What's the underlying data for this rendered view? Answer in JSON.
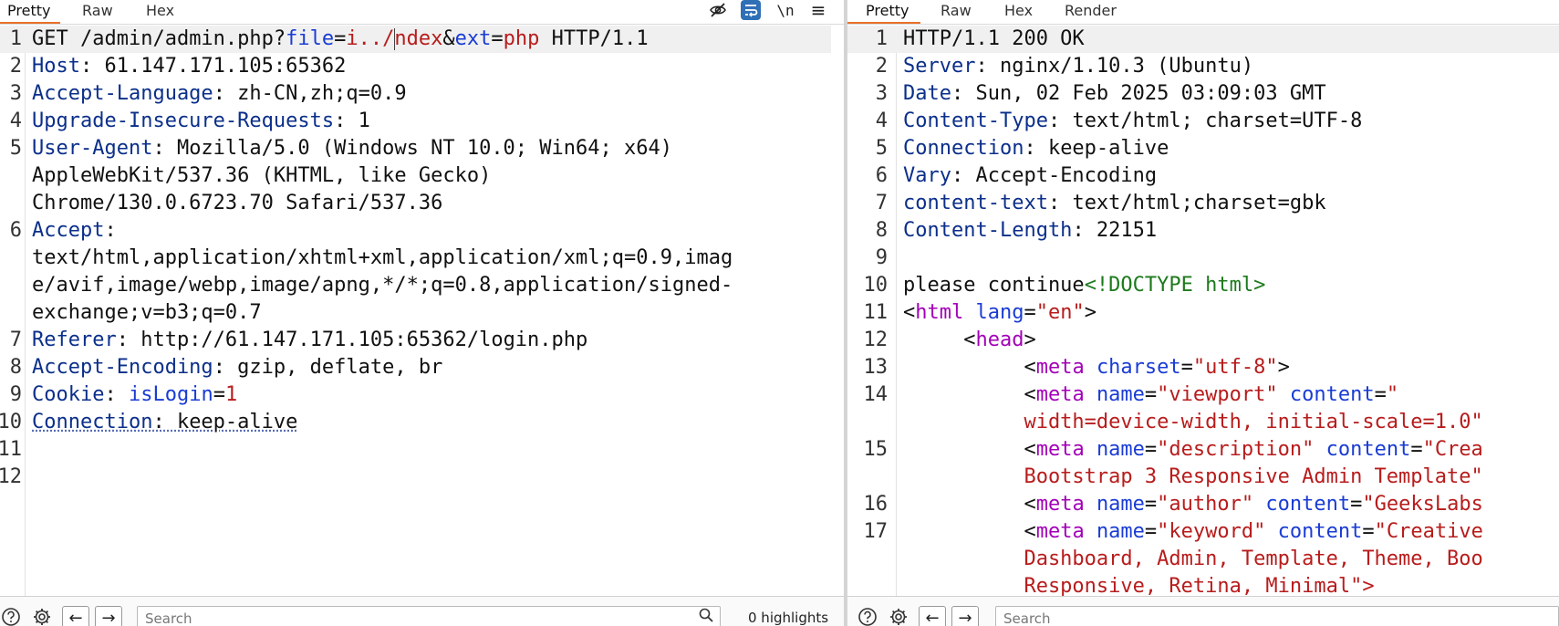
{
  "request": {
    "tabs": [
      "Pretty",
      "Raw",
      "Hex"
    ],
    "toolbar_icons": [
      "hide-icon",
      "wrap-lines-icon",
      "newline-icon",
      "menu-icon"
    ],
    "toolbar_glyphs": {
      "newline": "\\n",
      "menu": "≡"
    },
    "line_numbers": [
      "1",
      "2",
      "3",
      "4",
      "5",
      "6",
      "7",
      "8",
      "9",
      "10",
      "11",
      "12"
    ],
    "lines": {
      "l1": {
        "method": "GET ",
        "path": "/admin/admin.php?",
        "p1name": "file",
        "eq1": "=",
        "p1val_a": "i../",
        "p1val_b": "ndex",
        "amp": "&",
        "p2name": "ext",
        "eq2": "=",
        "p2val": "php",
        "proto": " HTTP/1.1"
      },
      "l2": {
        "key": "Host",
        "value": ": 61.147.171.105:65362"
      },
      "l3": {
        "key": "Accept-Language",
        "value": ": zh-CN,zh;q=0.9"
      },
      "l4": {
        "key": "Upgrade-Insecure-Requests",
        "value": ": 1"
      },
      "l5": {
        "key": "User-Agent",
        "value": ": Mozilla/5.0 (Windows NT 10.0; Win64; x64)",
        "wrap1": "AppleWebKit/537.36 (KHTML, like Gecko)",
        "wrap2": "Chrome/130.0.6723.70 Safari/537.36"
      },
      "l6": {
        "key": "Accept",
        "value": ":",
        "wrap1": "text/html,application/xhtml+xml,application/xml;q=0.9,imag",
        "wrap2": "e/avif,image/webp,image/apng,*/*;q=0.8,application/signed-",
        "wrap3": "exchange;v=b3;q=0.7"
      },
      "l7": {
        "key": "Referer",
        "value": ": http://61.147.171.105:65362/login.php"
      },
      "l8": {
        "key": "Accept-Encoding",
        "value": ": gzip, deflate, br"
      },
      "l9": {
        "key": "Cookie",
        "value": ": ",
        "cname": "isLogin",
        "ceq": "=",
        "cval": "1"
      },
      "l10": {
        "key": "Connection",
        "value": ": keep-alive"
      }
    },
    "search": {
      "placeholder": "Search"
    },
    "highlights": "0 highlights"
  },
  "response": {
    "tabs": [
      "Pretty",
      "Raw",
      "Hex",
      "Render"
    ],
    "line_numbers": [
      "1",
      "2",
      "3",
      "4",
      "5",
      "6",
      "7",
      "8",
      "9",
      "10",
      "11",
      "12",
      "13",
      "14",
      "15",
      "16",
      "17"
    ],
    "lines": {
      "l1": {
        "text": "HTTP/1.1 200 OK"
      },
      "l2": {
        "key": "Server",
        "value": ": nginx/1.10.3 (Ubuntu)"
      },
      "l3": {
        "key": "Date",
        "value": ": Sun, 02 Feb 2025 03:09:03 GMT"
      },
      "l4": {
        "key": "Content-Type",
        "value": ": text/html; charset=UTF-8"
      },
      "l5": {
        "key": "Connection",
        "value": ": keep-alive"
      },
      "l6": {
        "key": "Vary",
        "value": ": Accept-Encoding"
      },
      "l7": {
        "key": "content-text",
        "value": ": text/html;charset=gbk"
      },
      "l8": {
        "key": "Content-Length",
        "value": ": 22151"
      },
      "l10": {
        "text": "please continue",
        "doctype": "<!DOCTYPE html>"
      },
      "l11": {
        "open": "<",
        "tag": "html",
        "sp": " ",
        "attr": "lang",
        "eq": "=",
        "val": "\"en\"",
        "close": ">"
      },
      "l12": {
        "indent": "     ",
        "open": "<",
        "tag": "head",
        "close": ">"
      },
      "l13": {
        "indent": "          ",
        "open": "<",
        "tag": "meta",
        "sp": " ",
        "attr": "charset",
        "eq": "=",
        "val": "\"utf-8\"",
        "close": ">"
      },
      "l14": {
        "indent": "          ",
        "open": "<",
        "tag": "meta",
        "sp": " ",
        "attr": "name",
        "eq": "=",
        "val": "\"viewport\"",
        "sp2": " ",
        "attr2": "content",
        "eq2": "=",
        "val2": "\"",
        "wrap1": "          width=device-width, initial-scale=1.0\""
      },
      "l15": {
        "indent": "          ",
        "open": "<",
        "tag": "meta",
        "sp": " ",
        "attr": "name",
        "eq": "=",
        "val": "\"description\"",
        "sp2": " ",
        "attr2": "content",
        "eq2": "=",
        "val2": "\"Crea",
        "wrap1": "          Bootstrap 3 Responsive Admin Template\""
      },
      "l16": {
        "indent": "          ",
        "open": "<",
        "tag": "meta",
        "sp": " ",
        "attr": "name",
        "eq": "=",
        "val": "\"author\"",
        "sp2": " ",
        "attr2": "content",
        "eq2": "=",
        "val2": "\"GeeksLabs"
      },
      "l17": {
        "indent": "          ",
        "open": "<",
        "tag": "meta",
        "sp": " ",
        "attr": "name",
        "eq": "=",
        "val": "\"keyword\"",
        "sp2": " ",
        "attr2": "content",
        "eq2": "=",
        "val2": "\"Creative",
        "wrap1": "          Dashboard, Admin, Template, Theme, Boo",
        "wrap2": "          Responsive, Retina, Minimal\">"
      }
    },
    "search": {
      "placeholder": "Search"
    }
  }
}
